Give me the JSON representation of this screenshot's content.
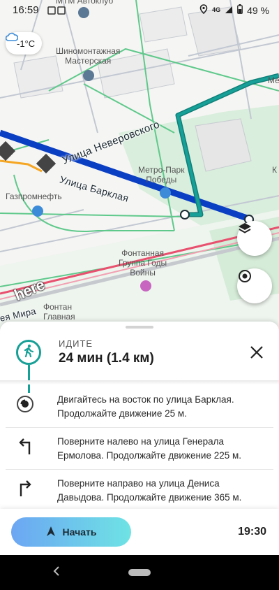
{
  "status": {
    "time": "16:59",
    "network": "4G",
    "battery": "49 %"
  },
  "weather": {
    "icon": "cloud-icon",
    "temp": "-1°C"
  },
  "map": {
    "top_poi": "МТМ Автоклуб",
    "poi_tire_1": "Шиномонтажная",
    "poi_tire_2": "Мастерская",
    "poi_metro_1": "Метро-Парк",
    "poi_metro_2": "Победы",
    "poi_gas": "Газпромнефть",
    "poi_fountain_1": "Фонтанная",
    "poi_fountain_2": "Группа Годы",
    "poi_fountain_3": "Войны",
    "poi_fontan_1": "Фонтан",
    "poi_fontan_2": "Главная",
    "street_nev": "Улица Неверовского",
    "street_bar": "Улица Барклая",
    "street_mira": "ея Мира",
    "edge_me": "Ме",
    "edge_k": "К",
    "logo": "here"
  },
  "summary": {
    "mode": "ИДИТЕ",
    "duration": "24 мин (1.4 км)"
  },
  "steps": [
    {
      "icon": "start-point-icon",
      "text": "Двигайтесь на восток по улица Барклая. Продолжайте движение 25 м."
    },
    {
      "icon": "turn-left-icon",
      "text": "Поверните налево на улица Генерала Ермолова. Продолжайте движение 225 м."
    },
    {
      "icon": "turn-right-icon",
      "text": "Поверните направо на улица Дениса Давыдова. Продолжайте движение 365 м."
    }
  ],
  "action": {
    "start_label": "Начать",
    "arrival": "19:30"
  },
  "colors": {
    "route_drive": "#0a3fc4",
    "route_walk": "#17a097",
    "accent": "#17a097",
    "rail": "#e8506e"
  }
}
